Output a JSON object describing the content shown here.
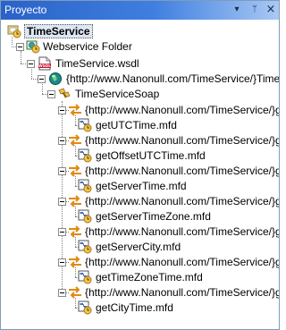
{
  "panel": {
    "title": "Proyecto",
    "controls": {
      "dropdown": "▾",
      "pin": "ᛘ",
      "close": "×"
    }
  },
  "tree": {
    "root": "TimeService",
    "folder": "Webservice Folder",
    "wsdl": "TimeService.wsdl",
    "service": "{http://www.Nanonull.com/TimeService/}TimeS",
    "port": "TimeServiceSoap",
    "operations": [
      {
        "op": "{http://www.Nanonull.com/TimeService/}g",
        "mapping": "getUTCTime.mfd"
      },
      {
        "op": "{http://www.Nanonull.com/TimeService/}g",
        "mapping": "getOffsetUTCTime.mfd"
      },
      {
        "op": "{http://www.Nanonull.com/TimeService/}g",
        "mapping": "getServerTime.mfd"
      },
      {
        "op": "{http://www.Nanonull.com/TimeService/}g",
        "mapping": "getServerTimeZone.mfd"
      },
      {
        "op": "{http://www.Nanonull.com/TimeService/}g",
        "mapping": "getServerCity.mfd"
      },
      {
        "op": "{http://www.Nanonull.com/TimeService/}g",
        "mapping": "getTimeZoneTime.mfd"
      },
      {
        "op": "{http://www.Nanonull.com/TimeService/}g",
        "mapping": "getCityTime.mfd"
      }
    ]
  },
  "colors": {
    "titlebar": "#2a62c7",
    "border": "#7f9db9",
    "selection": "#dde6f3",
    "arrow_orange": "#e08a12",
    "globe_teal": "#1a8a8a"
  }
}
